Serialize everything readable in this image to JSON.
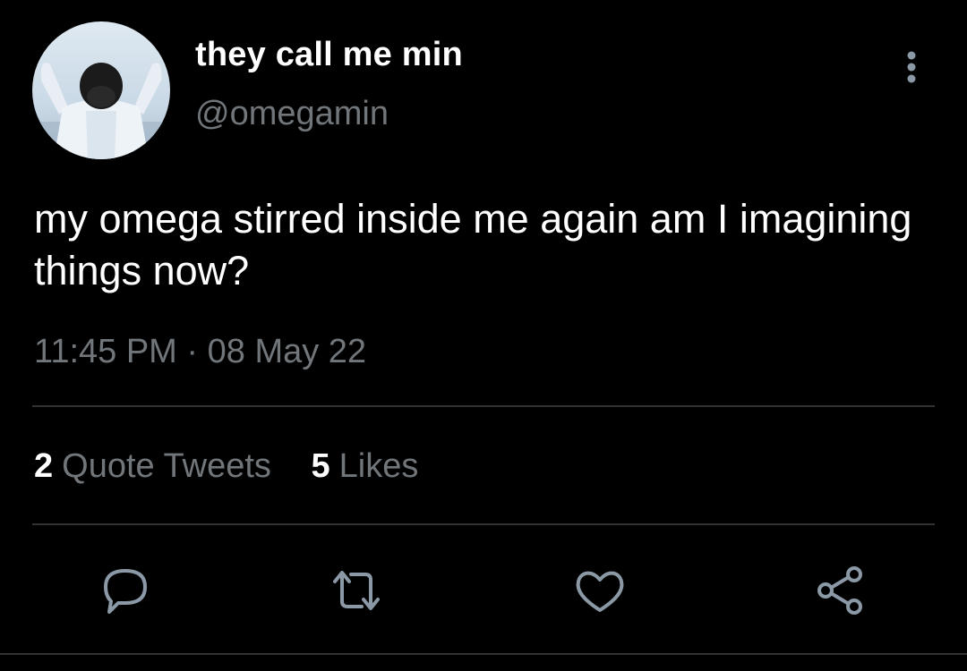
{
  "author": {
    "display_name": "they call me min",
    "handle": "@omegamin",
    "avatar_icon": "avatar-photo"
  },
  "tweet": {
    "text": "my omega stirred inside me again am I imagining things now?",
    "time": "11:45 PM",
    "separator": "·",
    "date": "08 May 22"
  },
  "stats": {
    "quote_tweets_count": "2",
    "quote_tweets_label": "Quote Tweets",
    "likes_count": "5",
    "likes_label": "Likes"
  },
  "actions": {
    "reply_icon": "reply-icon",
    "retweet_icon": "retweet-icon",
    "like_icon": "heart-icon",
    "share_icon": "share-icon",
    "more_icon": "more-vertical-icon"
  },
  "colors": {
    "background": "#000000",
    "primary_text": "#ffffff",
    "secondary_text": "#71767b",
    "divider": "#2f3336"
  }
}
